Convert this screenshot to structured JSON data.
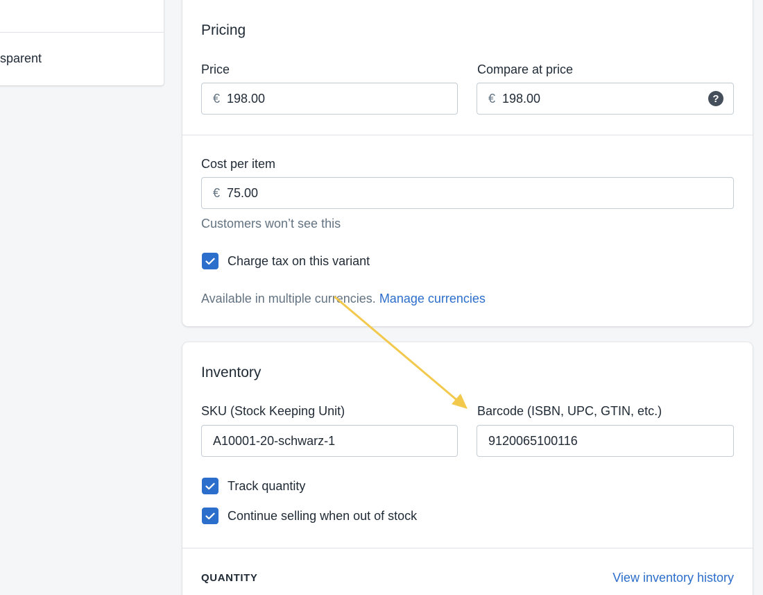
{
  "left_panel": {
    "partial_text": "sparent"
  },
  "pricing": {
    "title": "Pricing",
    "price_label": "Price",
    "price_prefix": "€",
    "price_value": "198.00",
    "compare_label": "Compare at price",
    "compare_prefix": "€",
    "compare_value": "198.00",
    "help_glyph": "?",
    "cost_label": "Cost per item",
    "cost_prefix": "€",
    "cost_value": "75.00",
    "cost_help": "Customers won’t see this",
    "charge_tax_label": "Charge tax on this variant",
    "charge_tax_checked": true,
    "currencies_text": "Available in multiple currencies.",
    "manage_currencies_link": "Manage currencies"
  },
  "inventory": {
    "title": "Inventory",
    "sku_label": "SKU (Stock Keeping Unit)",
    "sku_value": "A10001-20-schwarz-1",
    "barcode_label": "Barcode (ISBN, UPC, GTIN, etc.)",
    "barcode_value": "9120065100116",
    "track_quantity_label": "Track quantity",
    "track_quantity_checked": true,
    "continue_selling_label": "Continue selling when out of stock",
    "continue_selling_checked": true,
    "quantity_heading": "QUANTITY",
    "view_history_link": "View inventory history"
  },
  "colors": {
    "accent": "#2c6ecb",
    "annotation_arrow": "#f2c94c",
    "background": "#f4f6f8"
  }
}
